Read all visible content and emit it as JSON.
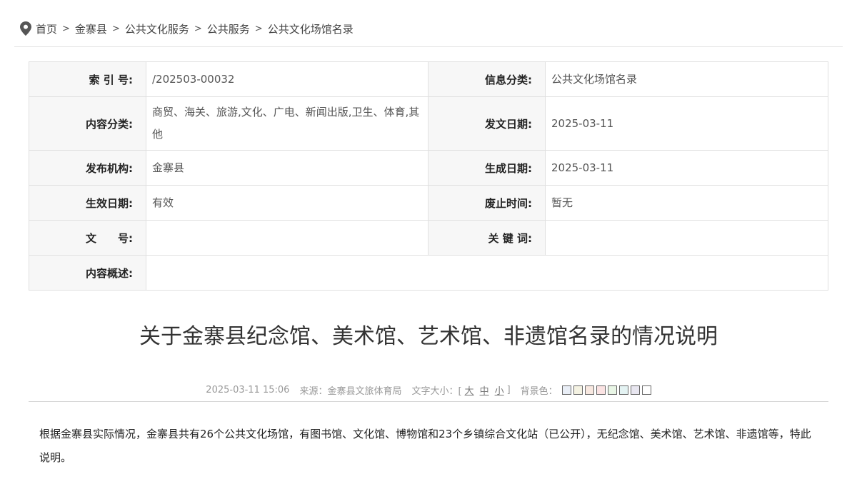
{
  "breadcrumb": {
    "items": [
      "首页",
      "金寨县",
      "公共文化服务",
      "公共服务",
      "公共文化场馆名录"
    ],
    "separator": ">"
  },
  "meta": {
    "index_no": {
      "label": "索 引 号:",
      "value": "/202503-00032"
    },
    "info_category": {
      "label": "信息分类:",
      "value": "公共文化场馆名录"
    },
    "content_category": {
      "label": "内容分类:",
      "value": "商贸、海关、旅游,文化、广电、新闻出版,卫生、体育,其他"
    },
    "issue_date": {
      "label": "发文日期:",
      "value": "2025-03-11"
    },
    "publisher": {
      "label": "发布机构:",
      "value": "金寨县"
    },
    "created_date": {
      "label": "生成日期:",
      "value": "2025-03-11"
    },
    "effective": {
      "label": "生效日期:",
      "value": "有效"
    },
    "repeal_time": {
      "label": "废止时间:",
      "value": "暂无"
    },
    "doc_no": {
      "label": "文　　号:",
      "value": ""
    },
    "keywords": {
      "label": "关 键 词:",
      "value": ""
    },
    "summary": {
      "label": "内容概述:",
      "value": ""
    }
  },
  "article": {
    "title": "关于金寨县纪念馆、美术馆、艺术馆、非遗馆名录的情况说明",
    "datetime": "2025-03-11 15:06",
    "source": "来源：金寨县文旅体育局",
    "font_size_label": "文字大小：[",
    "font_size_end": "]",
    "font_sizes": [
      "大",
      "中",
      "小"
    ],
    "bg_label": "背景色：",
    "body": "根据金寨县实际情况，金寨县共有26个公共文化场馆，有图书馆、文化馆、博物馆和23个乡镇综合文化站（已公开），无纪念馆、美术馆、艺术馆、非遗馆等，特此说明。"
  },
  "colors": {
    "bg_swatches": [
      "#e9eef6",
      "#f4f2e2",
      "#f8e8e0",
      "#fbe3e3",
      "#e9f6e6",
      "#e4f3f3",
      "#e8e6f0",
      "#ffffff"
    ]
  }
}
